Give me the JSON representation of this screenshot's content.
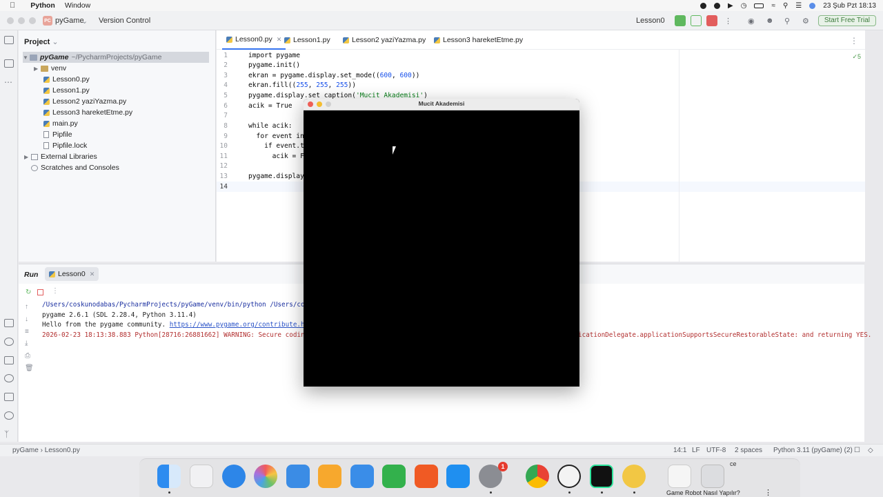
{
  "menubar": {
    "app_name": "Python",
    "menu_window": "Window",
    "clock": "23 Şub Pzt  18:13"
  },
  "toolbar": {
    "project_badge": "PC",
    "project_name": "pyGame",
    "vcs_label": "Version Control",
    "run_config": "Lesson0",
    "trial_button": "Start Free Trial"
  },
  "project_panel": {
    "title": "Project",
    "root_name": "pyGame",
    "root_path": "~/PycharmProjects/pyGame",
    "items": [
      {
        "label": "venv"
      },
      {
        "label": "Lesson0.py"
      },
      {
        "label": "Lesson1.py"
      },
      {
        "label": "Lesson2 yaziYazma.py"
      },
      {
        "label": "Lesson3 hareketEtme.py"
      },
      {
        "label": "main.py"
      },
      {
        "label": "Pipfile"
      },
      {
        "label": "Pipfile.lock"
      },
      {
        "label": "External Libraries"
      },
      {
        "label": "Scratches and Consoles"
      }
    ]
  },
  "editor": {
    "tabs": [
      {
        "label": "Lesson0.py"
      },
      {
        "label": "Lesson1.py"
      },
      {
        "label": "Lesson2 yaziYazma.py"
      },
      {
        "label": "Lesson3 hareketEtme.py"
      }
    ],
    "inspection_count": "✓5",
    "line_numbers": [
      "1",
      "2",
      "3",
      "4",
      "5",
      "6",
      "7",
      "8",
      "9",
      "10",
      "11",
      "12",
      "13",
      "14"
    ],
    "code": {
      "l1": "import pygame",
      "l2": "pygame.init()",
      "l3a": "ekran = pygame.display.set_mode((",
      "l3n1": "600",
      "l3c": ", ",
      "l3n2": "600",
      "l3b": "))",
      "l4a": "ekran.fill((",
      "l4n1": "255",
      "l4c1": ", ",
      "l4n2": "255",
      "l4c2": ", ",
      "l4n3": "255",
      "l4b": "))",
      "l5a": "pygame.display.set_caption(",
      "l5s": "'Mucit Akademisi'",
      "l5b": ")",
      "l6": "acik = True",
      "l8": "while acik:",
      "l9": "  for event in p",
      "l10": "    if event.typ",
      "l11": "      acik = Fa",
      "l13": "pygame.display.",
      "l14": ""
    }
  },
  "run_panel": {
    "title": "Run",
    "tab_label": "Lesson0",
    "console": {
      "cmd": "/Users/coskunodabas/PycharmProjects/pyGame/venv/bin/python /Users/coskuno",
      "line2": "pygame 2.6.1 (SDL 2.28.4, Python 3.11.4)",
      "line3_text": "Hello from the pygame community. ",
      "line3_link": "https://www.pygame.org/contribute.html",
      "line4_left": "2026-02-23 18:13:38.883 Python[28716:26881662] WARNING: Secure coding is",
      "line4_right": "icationDelegate.applicationSupportsSecureRestorableState: and returning YES."
    }
  },
  "status_bar": {
    "breadcrumb_project": "pyGame",
    "breadcrumb_file": "Lesson0.py",
    "position": "14:1",
    "line_ending": "LF",
    "encoding": "UTF-8",
    "indent": "2 spaces",
    "interpreter": "Python 3.11 (pyGame) (2)"
  },
  "pygame_window": {
    "title": "Mucit Akademisi"
  },
  "dock": {
    "settings_badge": "1",
    "overlay_caption": "Game Robot Nasıl Yapılır?",
    "overlay_fragment": "ce"
  }
}
